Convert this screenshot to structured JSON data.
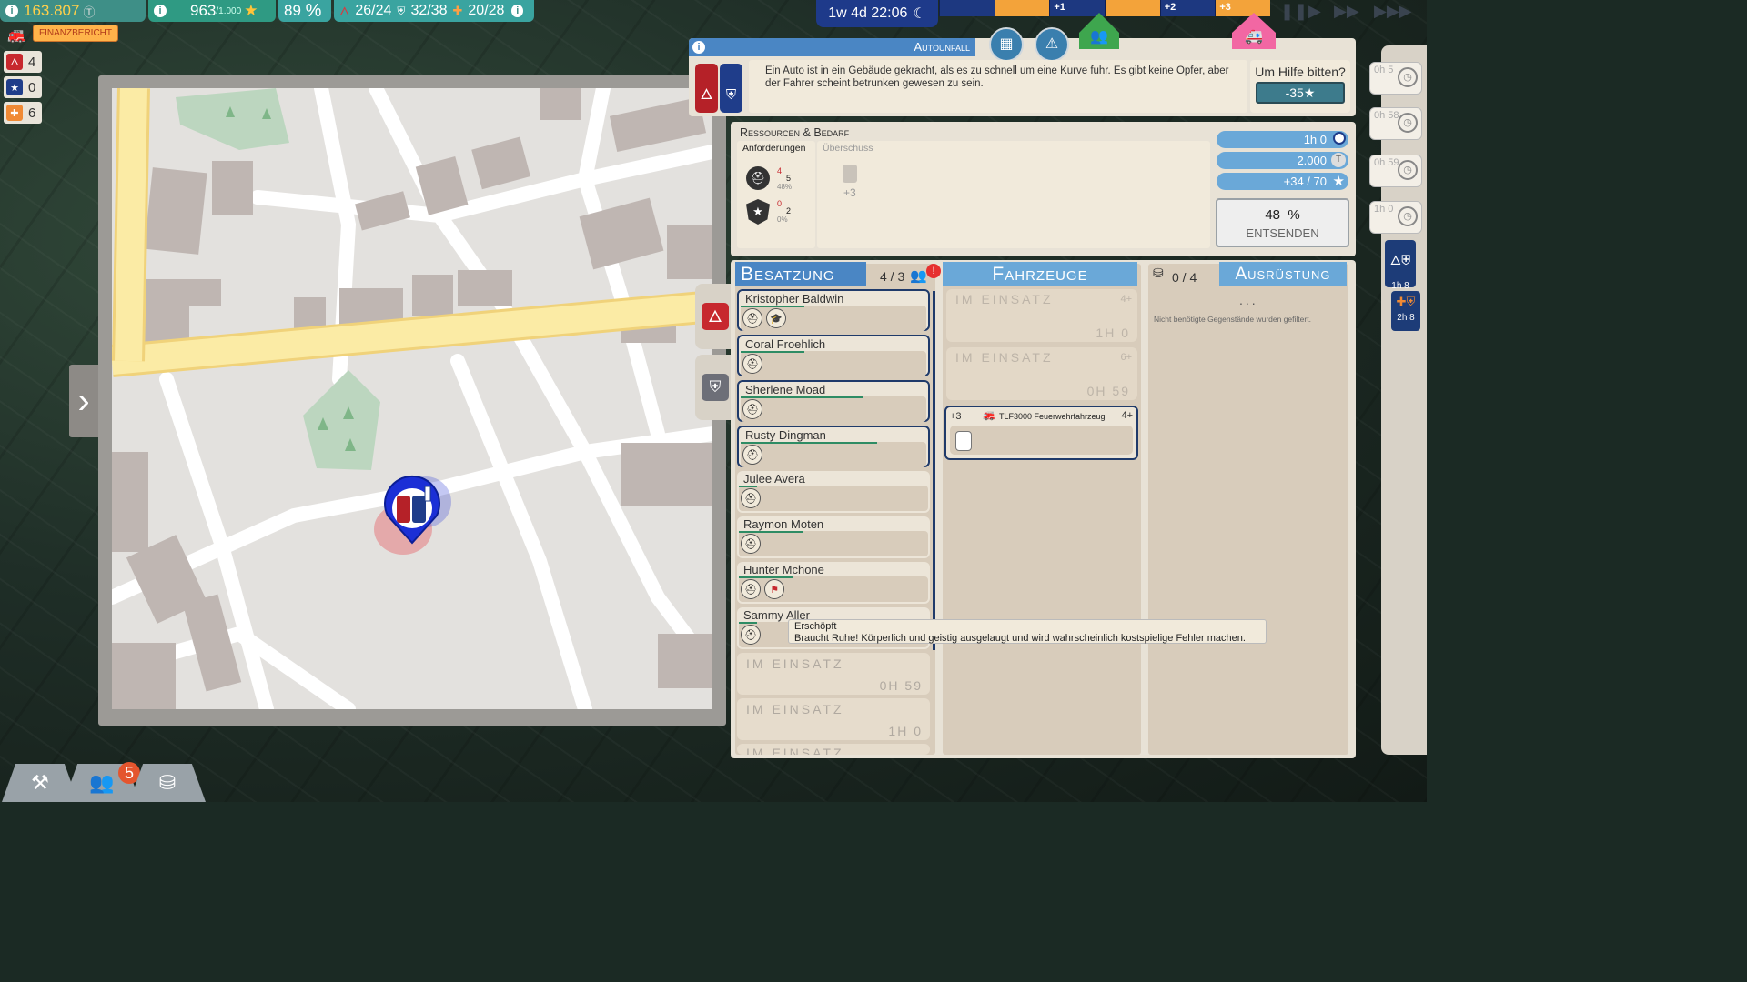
{
  "topbar": {
    "money": "163.807",
    "stars": "963",
    "stars_max": "/1.000",
    "satisfaction": "89",
    "satisfaction_unit": "%",
    "fire_units": "26/24",
    "police_units": "32/38",
    "medic_units": "20/28",
    "finance_report": "FINANZBERICHT"
  },
  "side_counts": {
    "fire": "4",
    "police": "0",
    "medic": "6"
  },
  "clock": {
    "time": "1w 4d 22:06"
  },
  "timeline": {
    "marks": [
      "+1",
      "+2",
      "+3"
    ]
  },
  "incident": {
    "title": "Autounfall",
    "description": "Ein Auto ist in ein Gebäude gekracht, als es zu schnell um eine Kurve fuhr. Es gibt keine Opfer, aber der Fahrer scheint betrunken gewesen zu sein.",
    "help_question": "Um Hilfe bitten?",
    "help_cost": "-35★"
  },
  "resources": {
    "title": "Ressourcen & Bedarf",
    "requirements_label": "Anforderungen",
    "surplus_label": "Überschuss",
    "req1": {
      "have": "4",
      "need": "5",
      "pct": "48%"
    },
    "req2": {
      "have": "0",
      "need": "2",
      "pct": "0%"
    },
    "surplus_value": "+3",
    "duration": "1h 0",
    "cost": "2.000",
    "reward": "+34 / 70",
    "success_pct": "48",
    "success_unit": "%",
    "send": "ENTSENDEN"
  },
  "crew": {
    "header": "Besatzung",
    "count": "4 / 3",
    "alert": "!",
    "members": [
      {
        "name": "Kristopher Baldwin"
      },
      {
        "name": "Coral Froehlich"
      },
      {
        "name": "Sherlene Moad"
      },
      {
        "name": "Rusty Dingman"
      },
      {
        "name": "Julee Avera"
      },
      {
        "name": "Raymon Moten"
      },
      {
        "name": "Hunter Mchone"
      },
      {
        "name": "Sammy Aller"
      }
    ],
    "busy": [
      {
        "label": "IM EINSATZ",
        "time": "0H 59"
      },
      {
        "label": "IM EINSATZ",
        "time": "1H 0"
      },
      {
        "label": "IM EINSATZ",
        "time": ""
      }
    ]
  },
  "vehicles": {
    "header": "Fahrzeuge",
    "busy": [
      {
        "label": "IM EINSATZ",
        "time": "1H 0",
        "cap": "4+"
      },
      {
        "label": "IM EINSATZ",
        "time": "0H 59",
        "cap": "6+"
      }
    ],
    "selected": {
      "bonus": "+3",
      "name": "TLF3000 Feuerwehrfahrzeug",
      "cap": "4+"
    }
  },
  "equipment": {
    "header": "Ausrüstung",
    "count": "0 / 4",
    "dots": "...",
    "note": "Nicht benötigte Gegenstände wurden gefiltert."
  },
  "tooltip": {
    "title": "Erschöpft",
    "text": "Braucht Ruhe! Körperlich und geistig ausgelaugt und wird wahrscheinlich kostspielige Fehler machen."
  },
  "queue": [
    {
      "time": "0h 5"
    },
    {
      "time": "0h 58"
    },
    {
      "time": "0h 59"
    },
    {
      "time": "1h 0"
    }
  ],
  "queue_cases": [
    {
      "time": "1h 8"
    },
    {
      "time": "2h 8"
    }
  ],
  "bottom": {
    "badge": "5"
  },
  "colors": {
    "fire": "#c7282e",
    "police": "#1f3d8a",
    "medic": "#f08a35",
    "accent": "#4a86c4"
  }
}
